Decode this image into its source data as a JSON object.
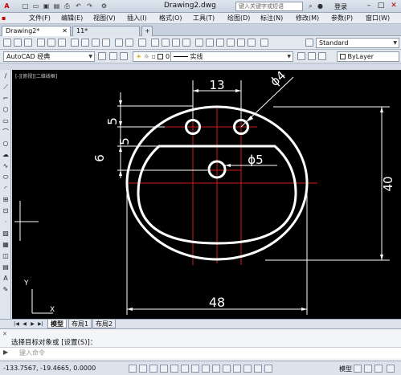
{
  "title_bar": {
    "title": "Drawing2.dwg",
    "search_placeholder": "键入关键字或短语",
    "login": "登录"
  },
  "menu": [
    "文件(F)",
    "编辑(E)",
    "视图(V)",
    "插入(I)",
    "格式(O)",
    "工具(T)",
    "绘图(D)",
    "标注(N)",
    "修改(M)",
    "参数(P)",
    "窗口(W)"
  ],
  "tabs": [
    "Drawing2*",
    "11*"
  ],
  "toolbar": {
    "text_style": "Standard",
    "workspace": "AutoCAD 经典",
    "layer": "0",
    "linetype": "实线",
    "color": "ByLayer"
  },
  "viewport": {
    "label": "[-][俯视][二维线框]",
    "background": "#000000",
    "ucs_y": "Y",
    "ucs_x": "X"
  },
  "drawing": {
    "dimensions": {
      "top_width": "13",
      "small_circle_dia": "ϕ4",
      "height_5_top": "5",
      "height_5_mid": "5",
      "height_6": "6",
      "drain_dia": "ϕ5",
      "overall_height": "40",
      "overall_width": "48"
    },
    "line_color": "#ffffff",
    "center_line_color": "#d21a1a"
  },
  "layout_tabs": [
    "模型",
    "布局1",
    "布局2"
  ],
  "command": {
    "history": "选择目标对象或 [设置(S)]：",
    "placeholder": "键入命令"
  },
  "status": {
    "coords": "-133.7567,  -19.4665,  0.0000",
    "model_label": "模型"
  }
}
